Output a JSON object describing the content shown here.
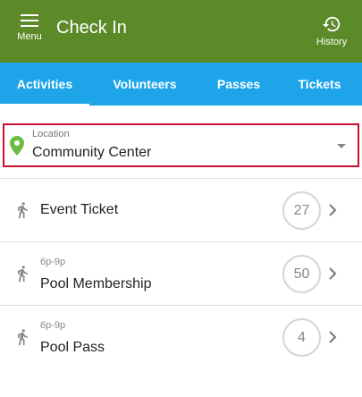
{
  "header": {
    "title": "Check In",
    "menu_label": "Menu",
    "history_label": "History",
    "background": "#5d8a28"
  },
  "tabs": {
    "active_color": "#1ea4e9",
    "items": [
      {
        "label": "Activities",
        "active": true
      },
      {
        "label": "Volunteers",
        "active": false
      },
      {
        "label": "Passes",
        "active": false
      },
      {
        "label": "Tickets",
        "active": false
      }
    ]
  },
  "location": {
    "label": "Location",
    "value": "Community Center",
    "icon": "map-pin-icon",
    "highlight_color": "#c8102e"
  },
  "activities": [
    {
      "time": "",
      "name": "Event Ticket",
      "count": "27",
      "icon": "runner-icon"
    },
    {
      "time": "6p-9p",
      "name": "Pool Membership",
      "count": "50",
      "icon": "runner-icon"
    },
    {
      "time": "6p-9p",
      "name": "Pool Pass",
      "count": "4",
      "icon": "runner-icon"
    }
  ]
}
